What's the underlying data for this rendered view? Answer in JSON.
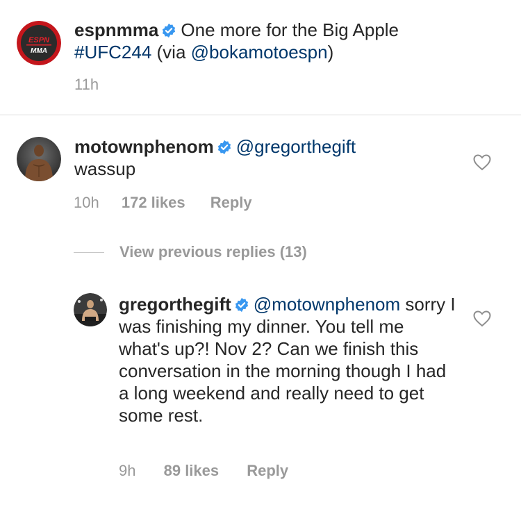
{
  "caption": {
    "avatar_name": "espn-mma-logo",
    "avatar_line1": "ESPN",
    "avatar_line2": "MMA",
    "username": "espnmma",
    "text": "One more for the Big Apple",
    "hashtag": "#UFC244",
    "via_prefix": "(via ",
    "via_mention": "@bokamotoespn",
    "via_suffix": ")",
    "time": "11h"
  },
  "comment": {
    "username": "motownphenom",
    "mention": "@gregorthegift",
    "text": "wassup",
    "time": "10h",
    "likes": "172 likes",
    "reply_label": "Reply"
  },
  "view_previous": "View previous replies (13)",
  "reply": {
    "username": "gregorthegift",
    "mention": "@motownphenom",
    "text": "sorry I was finishing my dinner.  You tell me what's up?! Nov 2?  Can we finish this conversation in the morning though I had a long weekend and really need to get some rest.",
    "time": "9h",
    "likes": "89 likes",
    "reply_label": "Reply"
  },
  "colors": {
    "verified_blue": "#3897f0",
    "link_blue": "#00376b",
    "meta_gray": "#999999",
    "espn_red": "#c4161c"
  },
  "icons": {
    "verified": "verified-badge-icon",
    "like": "heart-icon"
  }
}
